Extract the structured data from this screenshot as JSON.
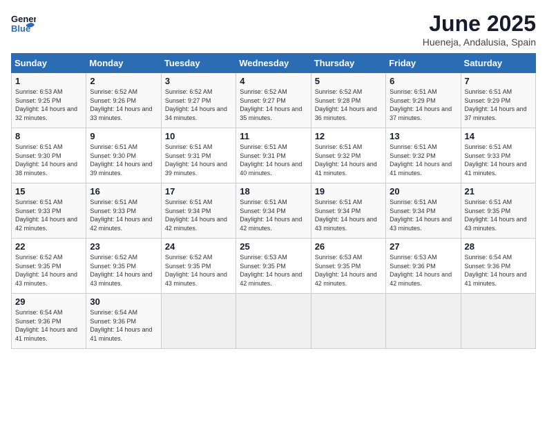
{
  "logo": {
    "general": "General",
    "blue": "Blue"
  },
  "header": {
    "month": "June 2025",
    "location": "Hueneja, Andalusia, Spain"
  },
  "weekdays": [
    "Sunday",
    "Monday",
    "Tuesday",
    "Wednesday",
    "Thursday",
    "Friday",
    "Saturday"
  ],
  "weeks": [
    [
      {
        "day": 1,
        "sunrise": "6:53 AM",
        "sunset": "9:25 PM",
        "daylight": "14 hours and 32 minutes."
      },
      {
        "day": 2,
        "sunrise": "6:52 AM",
        "sunset": "9:26 PM",
        "daylight": "14 hours and 33 minutes."
      },
      {
        "day": 3,
        "sunrise": "6:52 AM",
        "sunset": "9:27 PM",
        "daylight": "14 hours and 34 minutes."
      },
      {
        "day": 4,
        "sunrise": "6:52 AM",
        "sunset": "9:27 PM",
        "daylight": "14 hours and 35 minutes."
      },
      {
        "day": 5,
        "sunrise": "6:52 AM",
        "sunset": "9:28 PM",
        "daylight": "14 hours and 36 minutes."
      },
      {
        "day": 6,
        "sunrise": "6:51 AM",
        "sunset": "9:29 PM",
        "daylight": "14 hours and 37 minutes."
      },
      {
        "day": 7,
        "sunrise": "6:51 AM",
        "sunset": "9:29 PM",
        "daylight": "14 hours and 37 minutes."
      }
    ],
    [
      {
        "day": 8,
        "sunrise": "6:51 AM",
        "sunset": "9:30 PM",
        "daylight": "14 hours and 38 minutes."
      },
      {
        "day": 9,
        "sunrise": "6:51 AM",
        "sunset": "9:30 PM",
        "daylight": "14 hours and 39 minutes."
      },
      {
        "day": 10,
        "sunrise": "6:51 AM",
        "sunset": "9:31 PM",
        "daylight": "14 hours and 39 minutes."
      },
      {
        "day": 11,
        "sunrise": "6:51 AM",
        "sunset": "9:31 PM",
        "daylight": "14 hours and 40 minutes."
      },
      {
        "day": 12,
        "sunrise": "6:51 AM",
        "sunset": "9:32 PM",
        "daylight": "14 hours and 41 minutes."
      },
      {
        "day": 13,
        "sunrise": "6:51 AM",
        "sunset": "9:32 PM",
        "daylight": "14 hours and 41 minutes."
      },
      {
        "day": 14,
        "sunrise": "6:51 AM",
        "sunset": "9:33 PM",
        "daylight": "14 hours and 41 minutes."
      }
    ],
    [
      {
        "day": 15,
        "sunrise": "6:51 AM",
        "sunset": "9:33 PM",
        "daylight": "14 hours and 42 minutes."
      },
      {
        "day": 16,
        "sunrise": "6:51 AM",
        "sunset": "9:33 PM",
        "daylight": "14 hours and 42 minutes."
      },
      {
        "day": 17,
        "sunrise": "6:51 AM",
        "sunset": "9:34 PM",
        "daylight": "14 hours and 42 minutes."
      },
      {
        "day": 18,
        "sunrise": "6:51 AM",
        "sunset": "9:34 PM",
        "daylight": "14 hours and 42 minutes."
      },
      {
        "day": 19,
        "sunrise": "6:51 AM",
        "sunset": "9:34 PM",
        "daylight": "14 hours and 43 minutes."
      },
      {
        "day": 20,
        "sunrise": "6:51 AM",
        "sunset": "9:34 PM",
        "daylight": "14 hours and 43 minutes."
      },
      {
        "day": 21,
        "sunrise": "6:51 AM",
        "sunset": "9:35 PM",
        "daylight": "14 hours and 43 minutes."
      }
    ],
    [
      {
        "day": 22,
        "sunrise": "6:52 AM",
        "sunset": "9:35 PM",
        "daylight": "14 hours and 43 minutes."
      },
      {
        "day": 23,
        "sunrise": "6:52 AM",
        "sunset": "9:35 PM",
        "daylight": "14 hours and 43 minutes."
      },
      {
        "day": 24,
        "sunrise": "6:52 AM",
        "sunset": "9:35 PM",
        "daylight": "14 hours and 43 minutes."
      },
      {
        "day": 25,
        "sunrise": "6:53 AM",
        "sunset": "9:35 PM",
        "daylight": "14 hours and 42 minutes."
      },
      {
        "day": 26,
        "sunrise": "6:53 AM",
        "sunset": "9:35 PM",
        "daylight": "14 hours and 42 minutes."
      },
      {
        "day": 27,
        "sunrise": "6:53 AM",
        "sunset": "9:36 PM",
        "daylight": "14 hours and 42 minutes."
      },
      {
        "day": 28,
        "sunrise": "6:54 AM",
        "sunset": "9:36 PM",
        "daylight": "14 hours and 41 minutes."
      }
    ],
    [
      {
        "day": 29,
        "sunrise": "6:54 AM",
        "sunset": "9:36 PM",
        "daylight": "14 hours and 41 minutes."
      },
      {
        "day": 30,
        "sunrise": "6:54 AM",
        "sunset": "9:36 PM",
        "daylight": "14 hours and 41 minutes."
      },
      null,
      null,
      null,
      null,
      null
    ]
  ]
}
